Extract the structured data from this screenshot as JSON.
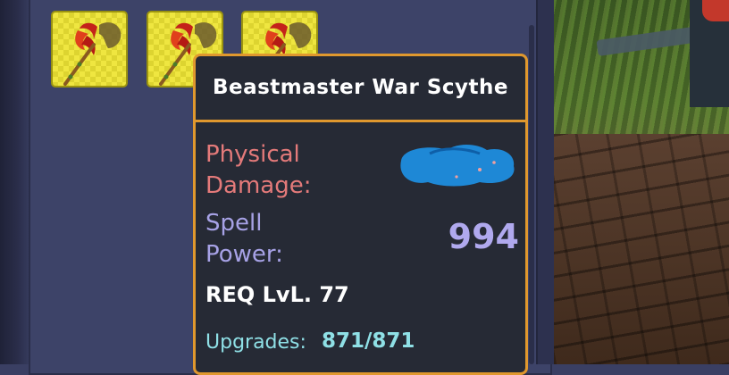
{
  "inventory": {
    "slots": [
      {
        "item_icon": "scythe-icon"
      },
      {
        "item_icon": "scythe-icon"
      },
      {
        "item_icon": "scythe-icon"
      }
    ],
    "slot_color": "#efe640"
  },
  "tooltip": {
    "title": "Beastmaster War Scythe",
    "border_color": "#e0982e",
    "physical_damage_label": "Physical\nDamage:",
    "physical_damage_value_redacted": true,
    "spell_power_label": "Spell\nPower:",
    "spell_power_value": "994",
    "req_level": "REQ LvL. 77",
    "upgrades_label": "Upgrades:",
    "upgrades_value": "871/871"
  },
  "colors": {
    "physical": "#e47a7a",
    "spell": "#a7a2e6",
    "upgrades": "#8fe0e6",
    "redaction": "#1e88d6"
  }
}
